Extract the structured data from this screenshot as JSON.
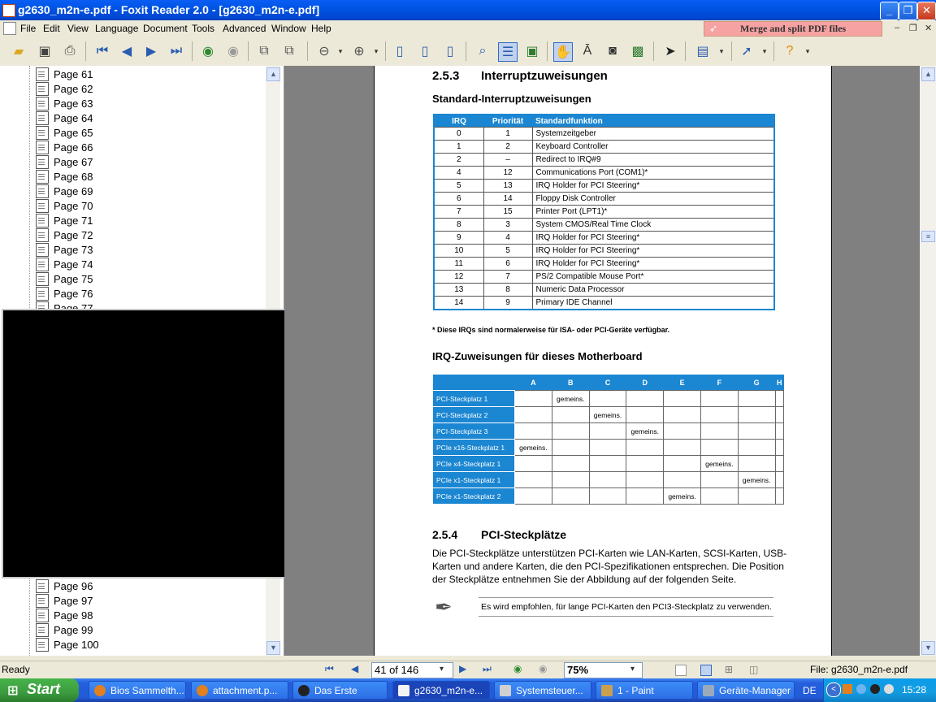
{
  "window": {
    "title": "g2630_m2n-e.pdf - Foxit Reader 2.0 - [g2630_m2n-e.pdf]"
  },
  "menu": {
    "items": [
      "File",
      "Edit",
      "View",
      "Language",
      "Document",
      "Tools",
      "Advanced",
      "Window",
      "Help"
    ],
    "banner": "Merge and split PDF files"
  },
  "toolbar": {
    "icons": [
      "open-icon",
      "save-icon",
      "print-icon",
      "first-page-icon",
      "prev-page-icon",
      "next-page-icon",
      "last-page-icon",
      "back-icon",
      "forward-icon",
      "rotate-icon",
      "copy-icon",
      "zoom-out-icon",
      "zoom-in-icon",
      "single-page-icon",
      "continuous-icon",
      "facing-icon",
      "find-icon",
      "bookmarks-icon",
      "thumbnails-icon",
      "hand-icon",
      "text-select-icon",
      "snapshot-icon",
      "image-icon",
      "select-icon",
      "form-icon",
      "tools-icon",
      "help-icon"
    ]
  },
  "sidebar": {
    "pages_top": [
      "Page 61",
      "Page 62",
      "Page 63",
      "Page 64",
      "Page 65",
      "Page 66",
      "Page 67",
      "Page 68",
      "Page 69",
      "Page 70",
      "Page 71",
      "Page 72",
      "Page 73",
      "Page 74",
      "Page 75",
      "Page 76",
      "Page 77"
    ],
    "pages_bottom": [
      "Page 96",
      "Page 97",
      "Page 98",
      "Page 99",
      "Page 100"
    ]
  },
  "doc": {
    "sec1_num": "2.5.3",
    "sec1_title": "Interruptzuweisungen",
    "sub1": "Standard-Interruptzuweisungen",
    "irq_headers": [
      "IRQ",
      "Priorität",
      "Standardfunktion"
    ],
    "irq_rows": [
      [
        "0",
        "1",
        "Systemzeitgeber"
      ],
      [
        "1",
        "2",
        "Keyboard Controller"
      ],
      [
        "2",
        "–",
        "Redirect to IRQ#9"
      ],
      [
        "4",
        "12",
        "Communications Port (COM1)*"
      ],
      [
        "5",
        "13",
        "IRQ Holder for PCI Steering*"
      ],
      [
        "6",
        "14",
        "Floppy Disk Controller"
      ],
      [
        "7",
        "15",
        "Printer Port (LPT1)*"
      ],
      [
        "8",
        "3",
        "System CMOS/Real Time Clock"
      ],
      [
        "9",
        "4",
        "IRQ Holder for PCI Steering*"
      ],
      [
        "10",
        "5",
        "IRQ Holder for PCI Steering*"
      ],
      [
        "11",
        "6",
        "IRQ Holder for PCI Steering*"
      ],
      [
        "12",
        "7",
        "PS/2 Compatible Mouse Port*"
      ],
      [
        "13",
        "8",
        "Numeric Data Processor"
      ],
      [
        "14",
        "9",
        "Primary IDE Channel"
      ]
    ],
    "footnote": "* Diese IRQs sind normalerweise für ISA- oder PCI-Geräte verfügbar.",
    "sub2": "IRQ-Zuweisungen für dieses Motherboard",
    "mb_headers": [
      "",
      "A",
      "B",
      "C",
      "D",
      "E",
      "F",
      "G",
      "H"
    ],
    "mb_rows": [
      [
        "PCI-Steckplatz 1",
        "",
        "gemeins.",
        "",
        "",
        "",
        "",
        "",
        ""
      ],
      [
        "PCI-Steckplatz 2",
        "",
        "",
        "gemeins.",
        "",
        "",
        "",
        "",
        ""
      ],
      [
        "PCI-Steckplatz 3",
        "",
        "",
        "",
        "gemeins.",
        "",
        "",
        "",
        ""
      ],
      [
        "PCIe x16-Steckplatz 1",
        "gemeins.",
        "",
        "",
        "",
        "",
        "",
        "",
        ""
      ],
      [
        "PCIe x4-Steckplatz 1",
        "",
        "",
        "",
        "",
        "",
        "gemeins.",
        "",
        ""
      ],
      [
        "PCIe x1-Steckplatz 1",
        "",
        "",
        "",
        "",
        "",
        "",
        "gemeins.",
        ""
      ],
      [
        "PCIe x1-Steckplatz 2",
        "",
        "",
        "",
        "",
        "gemeins.",
        "",
        "",
        ""
      ]
    ],
    "sec2_num": "2.5.4",
    "sec2_title": "PCI-Steckplätze",
    "para": [
      "Die PCI-Steckplätze unterstützen PCI-Karten wie LAN-Karten, SCSI-Karten, USB-",
      "Karten und andere Karten, die den PCI-Spezifikationen entsprechen. Die Position",
      "der Steckplätze entnehmen Sie der Abbildung auf der folgenden Seite."
    ],
    "note": "Es wird empfohlen, für lange PCI-Karten den PCI3-Steckplatz zu verwenden."
  },
  "status": {
    "ready": "Ready",
    "page_field": "41 of 146",
    "zoom": "75%",
    "file": "File: g2630_m2n-e.pdf"
  },
  "taskbar": {
    "start": "Start",
    "tasks": [
      "Bios Sammelth...",
      "attachment.p...",
      "Das Erste",
      "g2630_m2n-e...",
      "Systemsteuer...",
      "1 - Paint",
      "Geräte-Manager"
    ],
    "lang": "DE",
    "clock": "15:28"
  }
}
